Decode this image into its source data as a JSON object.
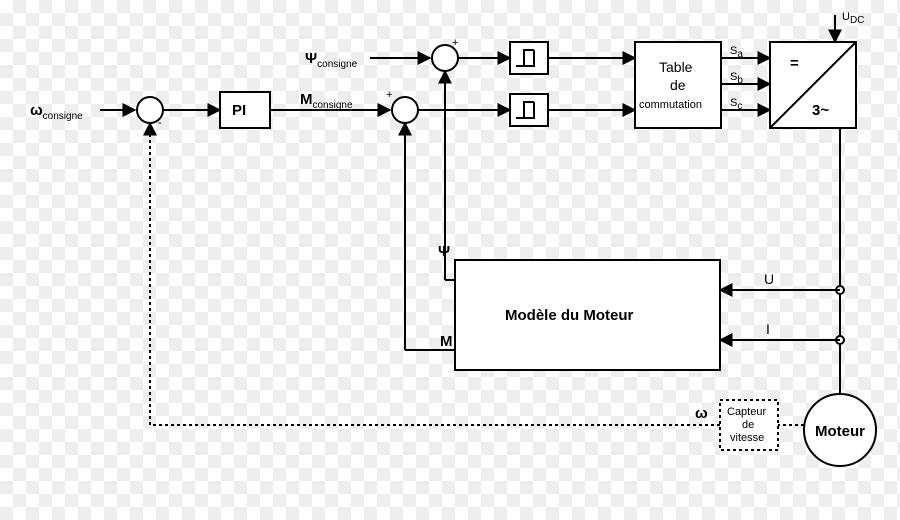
{
  "inputs": {
    "omega_ref": "ω",
    "omega_ref_sub": "consigne",
    "psi_ref": "Ψ",
    "psi_ref_sub": "consigne",
    "udc": "U",
    "udc_sub": "DC"
  },
  "signals": {
    "m_ref": "M",
    "m_ref_sub": "consigne",
    "psi": "Ψ",
    "m": "M",
    "omega": "ω",
    "u": "U",
    "i": "I",
    "sa": "S",
    "sa_sub": "a",
    "sb": "S",
    "sb_sub": "b",
    "sc": "S",
    "sc_sub": "c"
  },
  "blocks": {
    "pi": "PI",
    "table_l1": "Table",
    "table_l2": "de",
    "table_l3": "commutation",
    "inverter_top": "=",
    "inverter_bot": "3~",
    "model": "Modèle du Moteur",
    "speed_sensor_l1": "Capteur",
    "speed_sensor_l2": "de",
    "speed_sensor_l3": "vitesse",
    "motor": "Moteur"
  },
  "summing": {
    "plus": "+",
    "minus": "-"
  }
}
